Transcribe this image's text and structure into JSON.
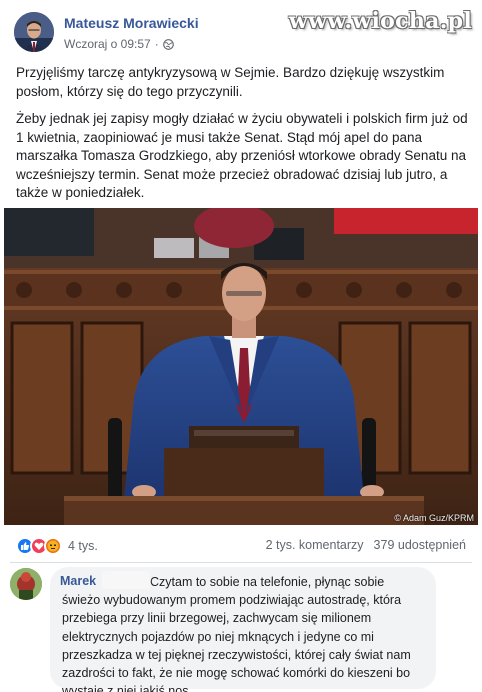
{
  "post": {
    "author": "Mateusz Morawiecki",
    "timestamp": "Wczoraj o 09:57",
    "separator": "·",
    "privacy_icon": "globe-icon",
    "paragraphs": [
      "Przyjęliśmy tarczę antykryzysową w Sejmie. Bardzo dziękuję wszystkim posłom, którzy się do tego przyczynili.",
      "Żeby jednak jej zapisy mogły działać w życiu obywateli i polskich firm już od 1 kwietnia, zaopiniować je musi także Senat. Stąd mój apel do pana marszałka Tomasza Grodzkiego, aby przeniósł wtorkowe obrady Senatu na wcześniejszy termin. Senat może przecież obradować dzisiaj lub jutro, a także w poniedziałek."
    ],
    "photo_credit": "© Adam Guz/KPRM"
  },
  "watermark": "www.wiocha.pl",
  "stats": {
    "reaction_icons": [
      "like-icon",
      "love-icon",
      "angry-icon"
    ],
    "reactions": "4 tys.",
    "comments": "2 tys. komentarzy",
    "shares": "379 udostępnień"
  },
  "comment": {
    "author": "Marek",
    "text": "Czytam to sobie na telefonie, płynąc sobie świeżo wybudowanym promem podziwiając autostradę, która przebiega przy linii brzegowej, zachwycam się milionem elektrycznych pojazdów po niej mknących i jedyne co mi przeszkadza w tej pięknej rzeczywistości, której cały świat nam zazdrości to fakt, że nie mogę schować komórki do kieszeni bo wystaje z niej jakiś nos..."
  },
  "colors": {
    "link_blue": "#385898",
    "secondary_text": "#606770",
    "bubble_bg": "#f2f3f5",
    "like_blue": "#1877f2",
    "love_red": "#f33e58",
    "angry_orange": "#e9710f"
  }
}
